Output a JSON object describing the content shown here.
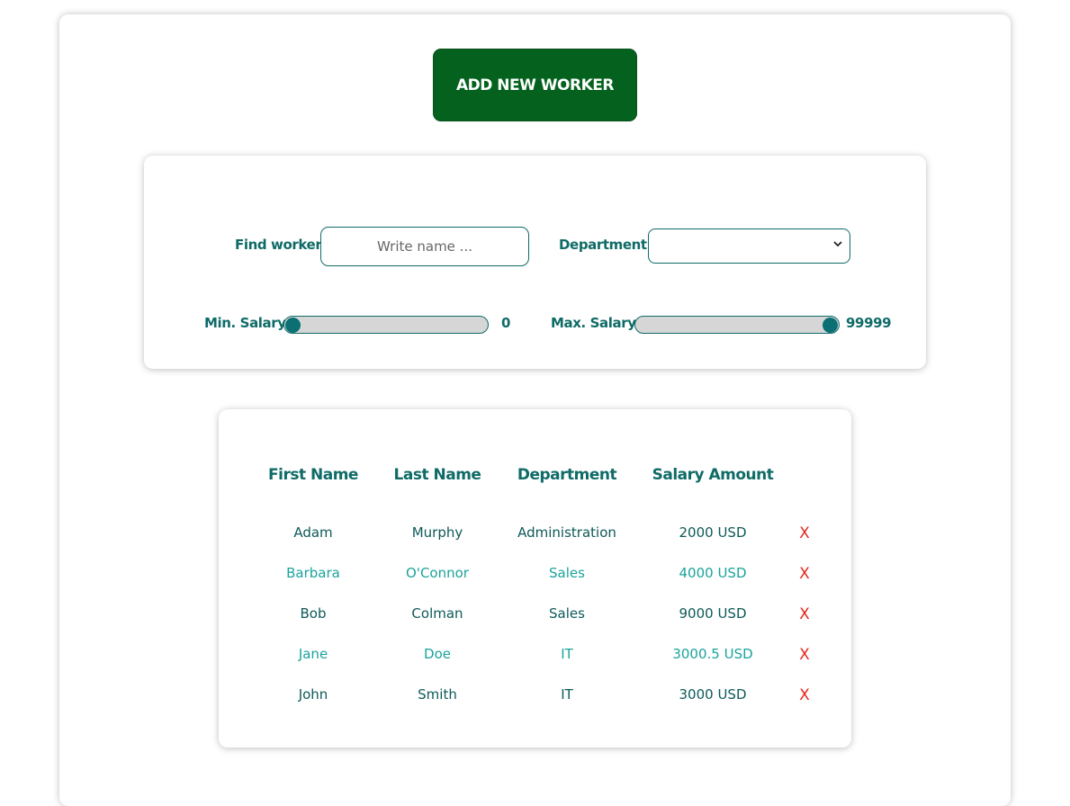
{
  "header": {
    "add_button_label": "ADD NEW WORKER"
  },
  "filters": {
    "find_label": "Find worker",
    "search_placeholder": "Write name ...",
    "search_value": "",
    "department_label": "Department",
    "department_value": "",
    "min_salary_label": "Min. Salary",
    "min_salary_value": "0",
    "max_salary_label": "Max. Salary",
    "max_salary_value": "99999"
  },
  "table": {
    "columns": [
      "First Name",
      "Last Name",
      "Department",
      "Salary Amount"
    ],
    "delete_label": "X",
    "rows": [
      {
        "first": "Adam",
        "last": "Murphy",
        "department": "Administration",
        "salary": "2000 USD"
      },
      {
        "first": "Barbara",
        "last": "O'Connor",
        "department": "Sales",
        "salary": "4000 USD"
      },
      {
        "first": "Bob",
        "last": "Colman",
        "department": "Sales",
        "salary": "9000 USD"
      },
      {
        "first": "Jane",
        "last": "Doe",
        "department": "IT",
        "salary": "3000.5 USD"
      },
      {
        "first": "John",
        "last": "Smith",
        "department": "IT",
        "salary": "3000 USD"
      }
    ]
  },
  "colors": {
    "primary_green": "#04621e",
    "teal_text": "#0f6b67",
    "teal_light": "#1ba39c",
    "delete_red": "#e4261c"
  },
  "icons": {
    "select": "chevron-down-icon"
  }
}
